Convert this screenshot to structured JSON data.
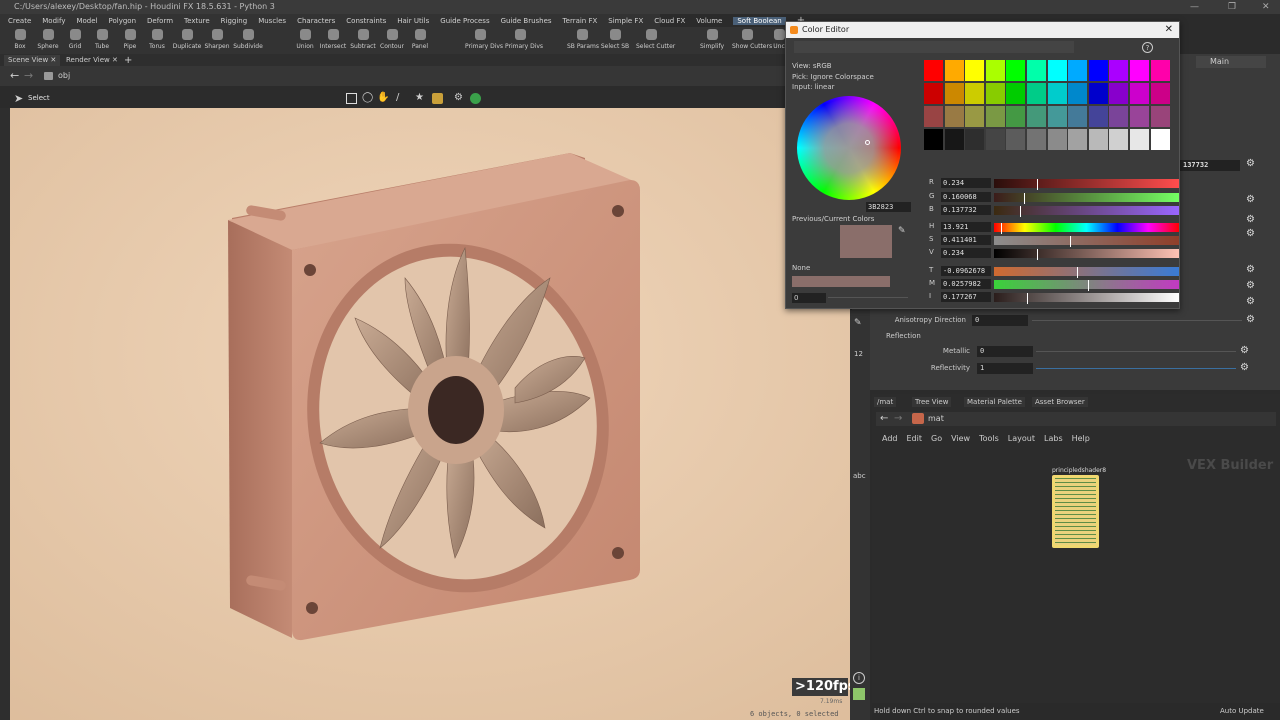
{
  "window": {
    "title": "C:/Users/alexey/Desktop/fan.hip - Houdini FX 18.5.631 - Python 3"
  },
  "menubar": [
    "Create",
    "Modify",
    "Model",
    "Polygon",
    "Deform",
    "Texture",
    "Rigging",
    "Muscles",
    "Characters",
    "Constraints",
    "Hair Utils",
    "Guide Process",
    "Guide Brushes",
    "Terrain FX",
    "Simple FX",
    "Cloud FX",
    "Volume",
    "Soft Boolean"
  ],
  "shelf_tools": [
    "Box",
    "Sphere",
    "Grid",
    "Tube",
    "Pipe",
    "Torus",
    "Duplicate",
    "Sharpen",
    "Subdivide",
    "Union",
    "Intersect",
    "Subtract",
    "Contour",
    "Panel",
    "Primary Divs",
    "Primary Divs",
    "SB Params",
    "Select SB",
    "Select Cutter",
    "Simplify",
    "Show Cutters",
    "Unc"
  ],
  "viewer_tabs": [
    "Scene View",
    "Render View"
  ],
  "path": "obj",
  "viewport": {
    "mode": "Select",
    "fps": ">120fps",
    "frame_time": "7.19ms",
    "status": "6 objects, 0 selected"
  },
  "color_editor": {
    "title": "Color Editor",
    "view_label": "View:",
    "view_value": "sRGB",
    "pick_label": "Pick:",
    "pick_value": "Ignore Colorspace",
    "input_label": "Input:",
    "input_value": "linear",
    "hex": "3B2823",
    "prev_current_label": "Previous/Current Colors",
    "none_label": "None",
    "alpha_value": "0",
    "current_color": "#8a6e6a",
    "palette": [
      [
        "#ff0000",
        "#ffaa00",
        "#ffff00",
        "#aaff00",
        "#00ff00",
        "#00ffaa",
        "#00ffff",
        "#00aaff",
        "#0000ff",
        "#aa00ff",
        "#ff00ff",
        "#ff00aa"
      ],
      [
        "#cc0000",
        "#cc8800",
        "#cccc00",
        "#88cc00",
        "#00cc00",
        "#00cc88",
        "#00cccc",
        "#0088cc",
        "#0000cc",
        "#8800cc",
        "#cc00cc",
        "#cc0088"
      ],
      [
        "#994444",
        "#997a44",
        "#999944",
        "#7a9944",
        "#449944",
        "#44997a",
        "#449999",
        "#447a99",
        "#444499",
        "#7a4499",
        "#994499",
        "#99447a"
      ],
      [
        "#000000",
        "#171717",
        "#2e2e2e",
        "#454545",
        "#5c5c5c",
        "#737373",
        "#8b8b8b",
        "#a2a2a2",
        "#b9b9b9",
        "#d0d0d0",
        "#e7e7e7",
        "#ffffff"
      ]
    ],
    "sliders": [
      {
        "label": "R",
        "value": "0.234",
        "gradient": "linear-gradient(90deg,#2a0e0b,#ff4d4d)",
        "pos": 0.234
      },
      {
        "label": "G",
        "value": "0.160068",
        "gradient": "linear-gradient(90deg,#3b1c1a,#74ff63)",
        "pos": 0.16
      },
      {
        "label": "B",
        "value": "0.137732",
        "gradient": "linear-gradient(90deg,#3b2a10,#9a66ff)",
        "pos": 0.14
      },
      {
        "label": "H",
        "value": "13.921",
        "gradient": "linear-gradient(90deg,#ff0000,#ffff00,#00ff00,#00ffff,#0000ff,#ff00ff,#ff0000)",
        "pos": 0.04
      },
      {
        "label": "S",
        "value": "0.411401",
        "gradient": "linear-gradient(90deg,#8d8d8d,#8f3f2a)",
        "pos": 0.41
      },
      {
        "label": "V",
        "value": "0.234",
        "gradient": "linear-gradient(90deg,#000000,#ffc2b4)",
        "pos": 0.234
      },
      {
        "label": "T",
        "value": "-0.0962678",
        "gradient": "linear-gradient(90deg,#d06a30,#3a7bd5)",
        "pos": 0.45
      },
      {
        "label": "M",
        "value": "0.0257982",
        "gradient": "linear-gradient(90deg,#3ad23a,#c23ac2)",
        "pos": 0.51
      },
      {
        "label": "I",
        "value": "0.177267",
        "gradient": "linear-gradient(90deg,#2a1d1b,#ffffff)",
        "pos": 0.18
      }
    ]
  },
  "params": {
    "main_label": "Main",
    "hex_field": "137732",
    "anisotropy_label": "Anisotropy Direction",
    "anisotropy_value": "0",
    "section_reflection": "Reflection",
    "metallic_label": "Metallic",
    "metallic_value": "0",
    "reflectivity_label": "Reflectivity",
    "reflectivity_value": "1"
  },
  "network": {
    "tabs": [
      "/mat",
      "Tree View",
      "Material Palette",
      "Asset Browser"
    ],
    "path": "mat",
    "menu": [
      "Add",
      "Edit",
      "Go",
      "View",
      "Tools",
      "Layout",
      "Labs",
      "Help"
    ],
    "context_label": "VEX Builder",
    "node_name": "principledshader8"
  },
  "statusbar": {
    "message": "Hold down Ctrl to snap to rounded values",
    "auto_update": "Auto Update"
  }
}
